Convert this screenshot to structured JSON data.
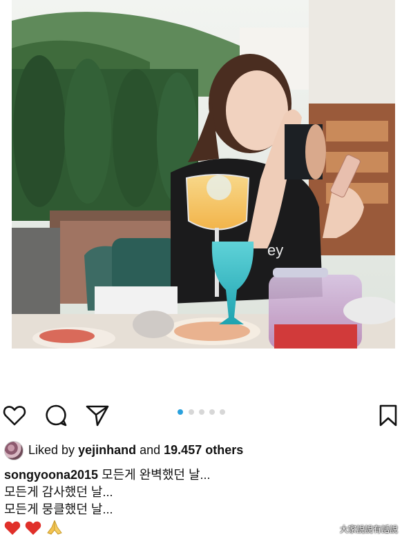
{
  "post": {
    "image_alt": "photo",
    "carousel": {
      "count": 5,
      "active_index": 0
    },
    "likes": {
      "prefix": "Liked by",
      "user": "yejinhand",
      "middle": "and",
      "count_text": "19.457 others"
    },
    "caption": {
      "username": "songyoona2015",
      "lines": [
        "모든게 완벽했던 날...",
        "모든게 감사했던 날...",
        "모든게 뭉클했던 날..."
      ],
      "emoji": [
        "❤️",
        "❤️",
        "🙏"
      ]
    }
  },
  "icons": {
    "like": "heart-outline-icon",
    "comment": "comment-bubble-icon",
    "share": "paper-plane-icon",
    "save": "bookmark-icon"
  },
  "watermark": "大家說說有話說",
  "colors": {
    "active_dot": "#2aa1dd",
    "inactive_dot": "#d7d7d7",
    "heart": "#e0302a"
  }
}
